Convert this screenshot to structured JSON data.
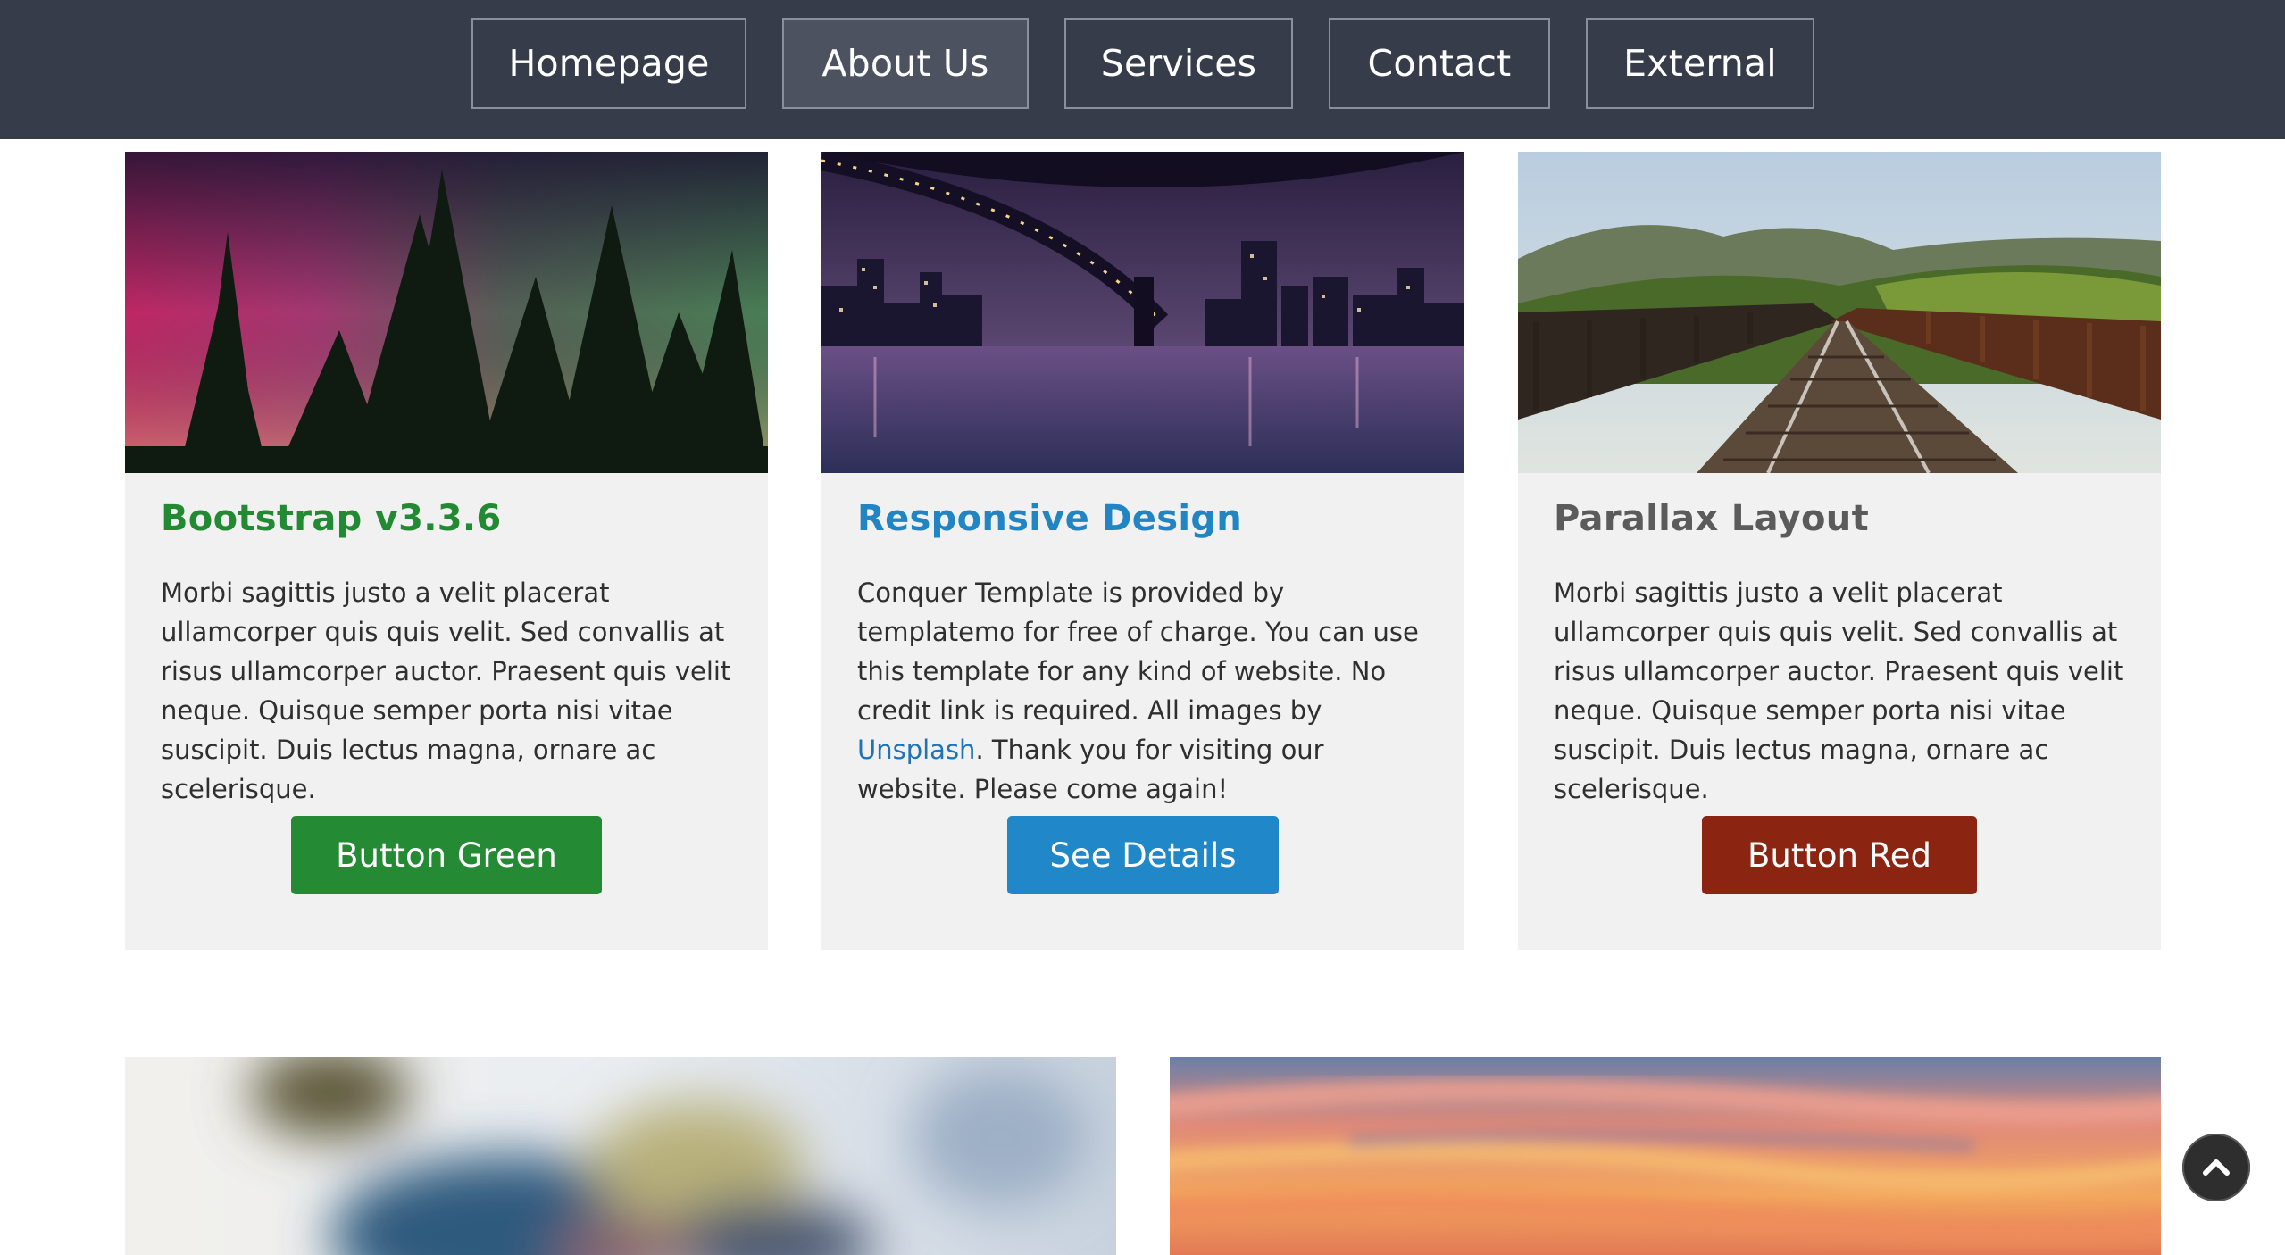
{
  "nav": {
    "items": [
      {
        "label": "Homepage",
        "active": false
      },
      {
        "label": "About Us",
        "active": true
      },
      {
        "label": "Services",
        "active": false
      },
      {
        "label": "Contact",
        "active": false
      },
      {
        "label": "External",
        "active": false
      }
    ]
  },
  "cards": [
    {
      "image": "aurora-forest-photo",
      "title": "Bootstrap v3.3.6",
      "text": "Morbi sagittis justo a velit placerat ullamcorper quis quis velit. Sed convallis at risus ullamcorper auctor. Praesent quis velit neque. Quisque semper porta nisi vitae suscipit. Duis lectus magna, ornare ac scelerisque.",
      "button": "Button Green",
      "title_color": "#238a34",
      "button_color": "#248a33"
    },
    {
      "image": "city-bridge-night-photo",
      "title": "Responsive Design",
      "text_before_link": "Conquer Template is provided by templatemo for free of charge. You can use this template for any kind of website. No credit link is required. All images by ",
      "link": "Unsplash",
      "text_after_link": ". Thank you for visiting our website. Please come again!",
      "button": "See Details",
      "title_color": "#2185c4",
      "button_color": "#2088c8"
    },
    {
      "image": "railway-bridge-photo",
      "title": "Parallax Layout",
      "text": "Morbi sagittis justo a velit placerat ullamcorper quis quis velit. Sed convallis at risus ullamcorper auctor. Praesent quis velit neque. Quisque semper porta nisi vitae suscipit. Duis lectus magna, ornare ac scelerisque.",
      "button": "Button Red",
      "title_color": "#5b5b5b",
      "button_color": "#8b2411"
    }
  ],
  "bottom_images": [
    "blurred-abstract-photo",
    "sunset-clouds-photo"
  ],
  "scroll_top_icon": "chevron-up-icon"
}
